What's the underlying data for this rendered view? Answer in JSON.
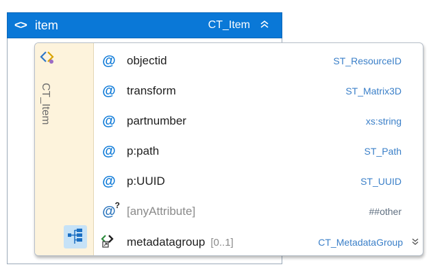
{
  "element": {
    "name": "item",
    "type": "CT_Item",
    "kind_icon": "element-icon",
    "collapse_glyph": "⌃"
  },
  "complex_type": {
    "label": "CT_Item"
  },
  "attributes": [
    {
      "name": "objectid",
      "type": "ST_ResourceID"
    },
    {
      "name": "transform",
      "type": "ST_Matrix3D"
    },
    {
      "name": "partnumber",
      "type": "xs:string"
    },
    {
      "name": "p:path",
      "type": "ST_Path"
    },
    {
      "name": "p:UUID",
      "type": "ST_UUID"
    }
  ],
  "any_attribute": {
    "name": "[anyAttribute]",
    "namespace": "##other"
  },
  "child_element": {
    "name": "metadatagroup",
    "occurs": "[0..1]",
    "type": "CT_MetadataGroup",
    "expand_glyph": "⌄"
  },
  "colors": {
    "header": "#0a78d7",
    "type_side": "#fdf3dc",
    "attribute_icon": "#0a78d7",
    "type_text": "#3a7fc8"
  }
}
